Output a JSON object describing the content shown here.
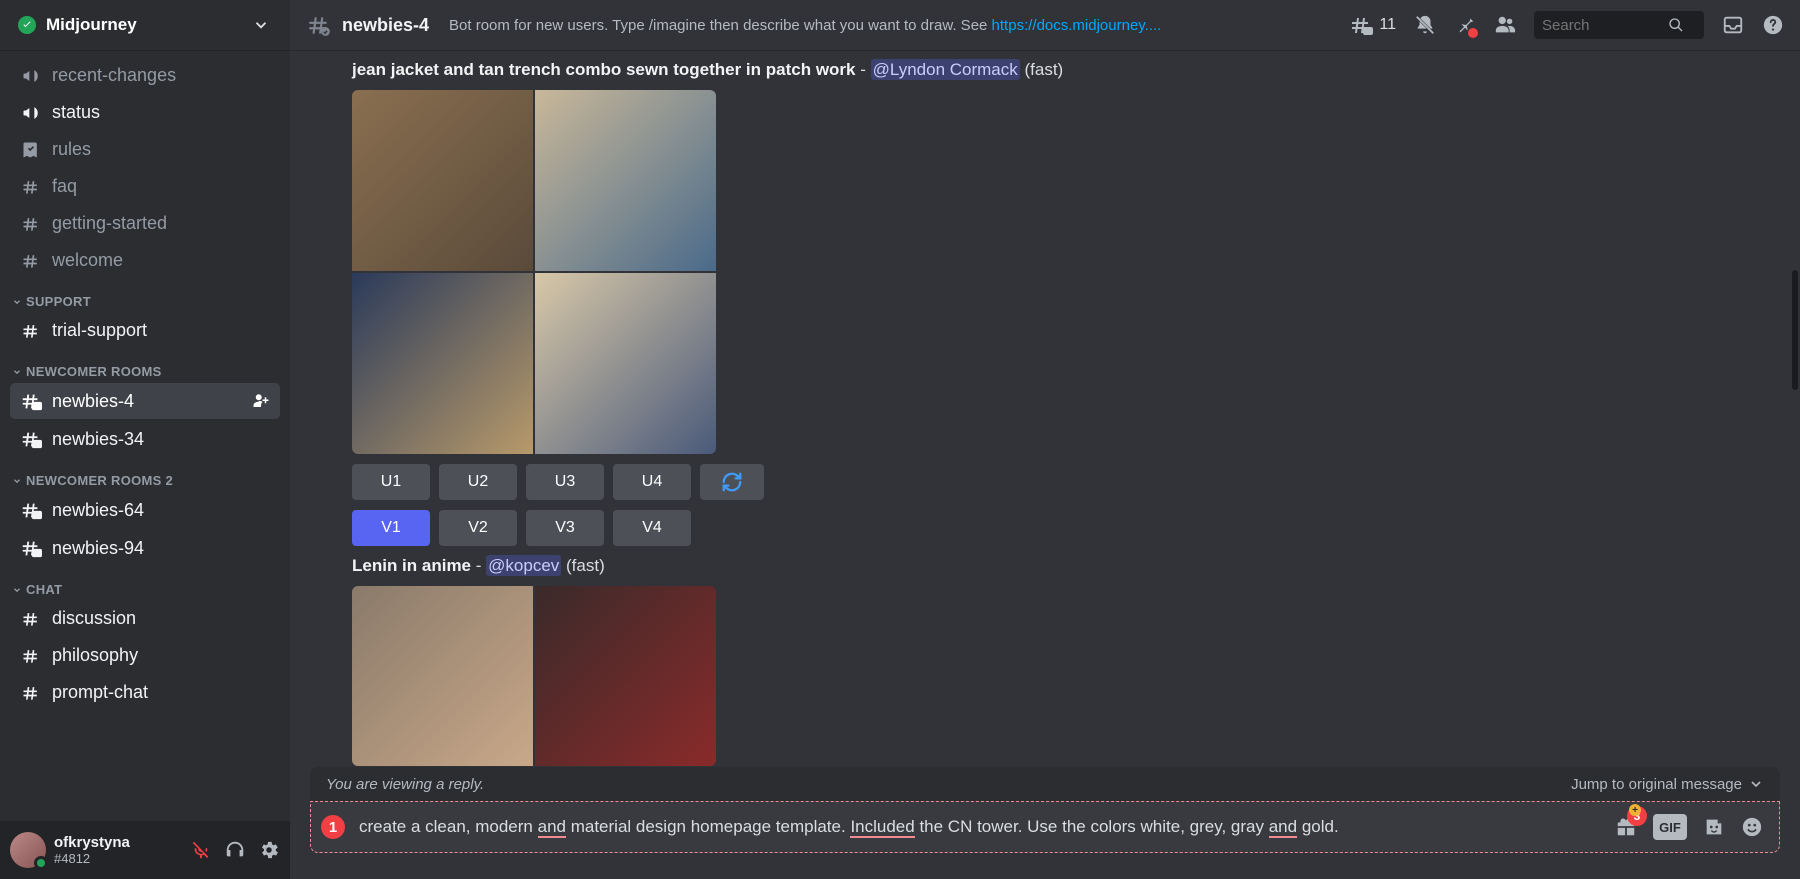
{
  "server_name": "Midjourney",
  "channels": [
    {
      "icon": "megaphone",
      "label": "recent-changes",
      "bold": false
    },
    {
      "icon": "megaphone",
      "label": "status",
      "bold": true
    },
    {
      "icon": "rules",
      "label": "rules",
      "bold": false
    },
    {
      "icon": "hash",
      "label": "faq",
      "bold": false
    },
    {
      "icon": "hash",
      "label": "getting-started",
      "bold": false
    },
    {
      "icon": "hash",
      "label": "welcome",
      "bold": false
    }
  ],
  "categories": [
    {
      "name": "SUPPORT",
      "items": [
        {
          "icon": "hash",
          "label": "trial-support",
          "bold": true
        }
      ]
    },
    {
      "name": "NEWCOMER ROOMS",
      "items": [
        {
          "icon": "hash-chat",
          "label": "newbies-4",
          "bold": true,
          "selected": true,
          "action": "add-user"
        },
        {
          "icon": "hash-chat",
          "label": "newbies-34",
          "bold": true
        }
      ]
    },
    {
      "name": "NEWCOMER ROOMS 2",
      "items": [
        {
          "icon": "hash-chat",
          "label": "newbies-64",
          "bold": true
        },
        {
          "icon": "hash-chat",
          "label": "newbies-94",
          "bold": true
        }
      ]
    },
    {
      "name": "CHAT",
      "items": [
        {
          "icon": "hash",
          "label": "discussion",
          "bold": true
        },
        {
          "icon": "hash",
          "label": "philosophy",
          "bold": true
        },
        {
          "icon": "hash",
          "label": "prompt-chat",
          "bold": true
        }
      ]
    }
  ],
  "user": {
    "name": "ofkrystyna",
    "tag": "#4812"
  },
  "header": {
    "channel_name": "newbies-4",
    "topic_prefix": "Bot room for new users. Type /imagine then describe what you want to draw. See ",
    "topic_link": "https://docs.midjourney....",
    "thread_count": "11",
    "search_placeholder": "Search"
  },
  "messages": [
    {
      "prompt": "jean jacket and tan trench combo sewn together in patch work",
      "mention": "@Lyndon Cormack",
      "suffix": "(fast)",
      "buttons_u": [
        "U1",
        "U2",
        "U3",
        "U4"
      ],
      "buttons_v": [
        "V1",
        "V2",
        "V3",
        "V4"
      ],
      "v_active": "V1"
    },
    {
      "prompt": "Lenin in anime",
      "mention": "@kopcev",
      "suffix": "(fast)"
    }
  ],
  "reply_bar": {
    "viewing": "You are viewing a reply.",
    "jump": "Jump to original message"
  },
  "input": {
    "num": "1",
    "text_parts": [
      {
        "t": "create a clean, modern ",
        "ul": false
      },
      {
        "t": "and",
        "ul": true
      },
      {
        "t": " material design homepage template. ",
        "ul": false
      },
      {
        "t": "Included",
        "ul": true
      },
      {
        "t": " the CN tower. Use the colors white, grey, gray ",
        "ul": false
      },
      {
        "t": "and",
        "ul": true
      },
      {
        "t": " gold.",
        "ul": false
      }
    ],
    "gift_count": "3",
    "gif_label": "GIF"
  }
}
